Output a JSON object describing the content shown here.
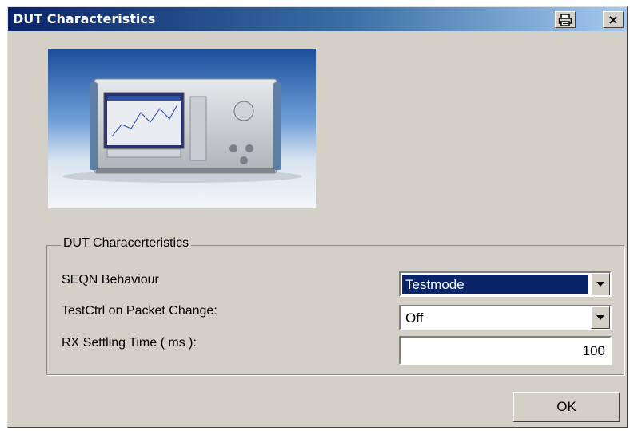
{
  "window": {
    "title": "DUT Characteristics",
    "print_icon": "printer-icon",
    "close_icon": "close-icon",
    "close_glyph": "×"
  },
  "image": {
    "description_icon": "instrument-photo"
  },
  "group": {
    "legend": "DUT Characerteristics",
    "fields": [
      {
        "label": "SEQN Behaviour",
        "type": "combo",
        "value": "Testmode",
        "selected": true
      },
      {
        "label": "TestCtrl on Packet Change:",
        "type": "combo",
        "value": "Off",
        "selected": false
      },
      {
        "label": "RX Settling Time ( ms ):",
        "type": "number",
        "value": "100"
      }
    ]
  },
  "buttons": {
    "ok": "OK"
  },
  "colors": {
    "titlebar_start": "#0a246a",
    "titlebar_end": "#a6caf0",
    "selection": "#0a246a",
    "face": "#d4d0c8"
  }
}
